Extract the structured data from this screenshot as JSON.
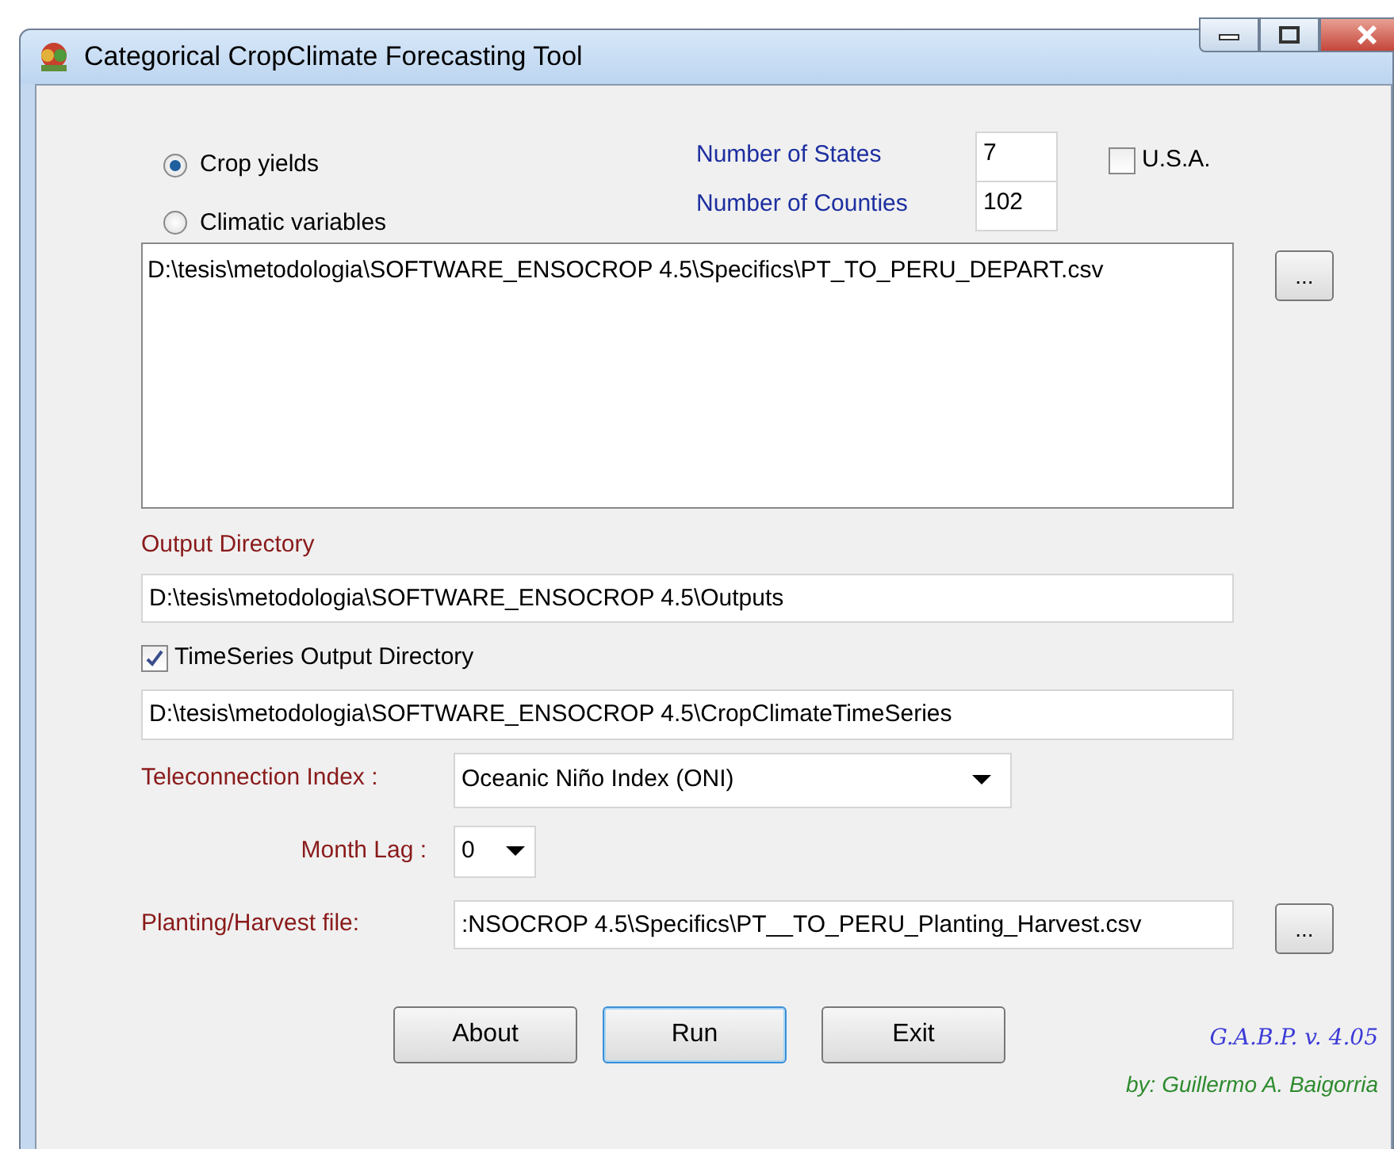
{
  "window": {
    "title": "Categorical CropClimate Forecasting Tool"
  },
  "data_type": [
    {
      "label": "Crop yields",
      "selected": true
    },
    {
      "label": "Climatic variables",
      "selected": false
    }
  ],
  "number_of_states": {
    "label": "Number of States",
    "value": "7"
  },
  "number_of_counties": {
    "label": "Number of Counties",
    "value": "102"
  },
  "usa": {
    "label": "U.S.A.",
    "checked": false
  },
  "input_file": {
    "value": "D:\\tesis\\metodologia\\SOFTWARE_ENSOCROP 4.5\\Specifics\\PT_TO_PERU_DEPART.csv",
    "browse": "..."
  },
  "output_directory": {
    "label": "Output Directory",
    "value": "D:\\tesis\\metodologia\\SOFTWARE_ENSOCROP 4.5\\Outputs"
  },
  "timeseries_output": {
    "label": "TimeSeries Output Directory",
    "checked": true,
    "value": "D:\\tesis\\metodologia\\SOFTWARE_ENSOCROP 4.5\\CropClimateTimeSeries"
  },
  "teleconnection_index": {
    "label": "Teleconnection Index :",
    "value": "Oceanic Niño Index (ONI)"
  },
  "month_lag": {
    "label": "Month Lag :",
    "value": "0"
  },
  "planting_harvest_file": {
    "label": "Planting/Harvest file:",
    "value": ":NSOCROP 4.5\\Specifics\\PT__TO_PERU_Planting_Harvest.csv",
    "browse": "..."
  },
  "buttons": [
    {
      "label": "About",
      "focused": false
    },
    {
      "label": "Run",
      "focused": true
    },
    {
      "label": "Exit",
      "focused": false
    }
  ],
  "version": "G.A.B.P. v. 4.05",
  "author": "by: Guillermo A. Baigorria"
}
